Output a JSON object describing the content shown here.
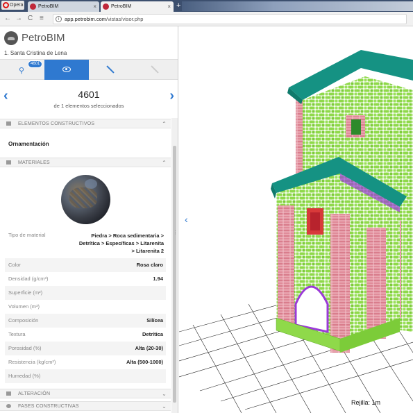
{
  "browser": {
    "menu_label": "Opera",
    "tabs": [
      {
        "title": "PetroBIM",
        "close": "×"
      },
      {
        "title": "PetroBIM",
        "close": "×"
      }
    ],
    "new_tab": "+",
    "url_domain": "app.petrobim.com",
    "url_path": "/vistas/visor.php",
    "nav": {
      "back": "←",
      "forward": "→",
      "reload": "C",
      "tabs_icon": "≡"
    }
  },
  "app": {
    "logo_prefix": "Petro",
    "logo_suffix": "BIM",
    "project": "1. Santa Cristina de Lena",
    "toolbar": {
      "search_badge": "4601",
      "tools": [
        "search-icon",
        "eye-icon",
        "pencil-icon",
        "pencil-disabled-icon"
      ],
      "active_tool": 1
    },
    "selection": {
      "id": "4601",
      "subtitle": "de 1 elementos seleccionados",
      "prev": "‹",
      "next": "›"
    },
    "sections": {
      "elementos": "ELEMENTOS CONSTRUCTIVOS",
      "materiales": "MATERIALES",
      "alteracion": "ALTERACIÓN",
      "fases": "FASES CONSTRUCTIVAS"
    },
    "elemento_tipo": "Ornamentación",
    "material": {
      "tipo_label": "Tipo de material",
      "tipo_value_lines": [
        "Piedra > Roca sedimentaria >",
        "Detrítica > Específicas > Litarenita",
        "> Litarenita 2"
      ],
      "props": [
        {
          "label": "Color",
          "value": "Rosa claro"
        },
        {
          "label": "Densidad (g/cm³)",
          "value": "1.94"
        },
        {
          "label": "Superficie (m²)",
          "value": ""
        },
        {
          "label": "Volumen (m³)",
          "value": ""
        },
        {
          "label": "Composición",
          "value": "Silícea"
        },
        {
          "label": "Textura",
          "value": "Detrítica"
        },
        {
          "label": "Porosidad (%)",
          "value": "Alta (20-30)"
        },
        {
          "label": "Resistencia (kg/cm²)",
          "value": "Alta (500-1000)"
        },
        {
          "label": "Humedad (%)",
          "value": ""
        }
      ]
    }
  },
  "viewer": {
    "grid_label": "Rejilla: 1m",
    "left_arrow": "‹",
    "colors": {
      "roof": "#159283",
      "stone": "#8fd94a",
      "trim": "#e08c9a",
      "window": "#d83a3a",
      "purple": "#9b3ad8"
    }
  }
}
